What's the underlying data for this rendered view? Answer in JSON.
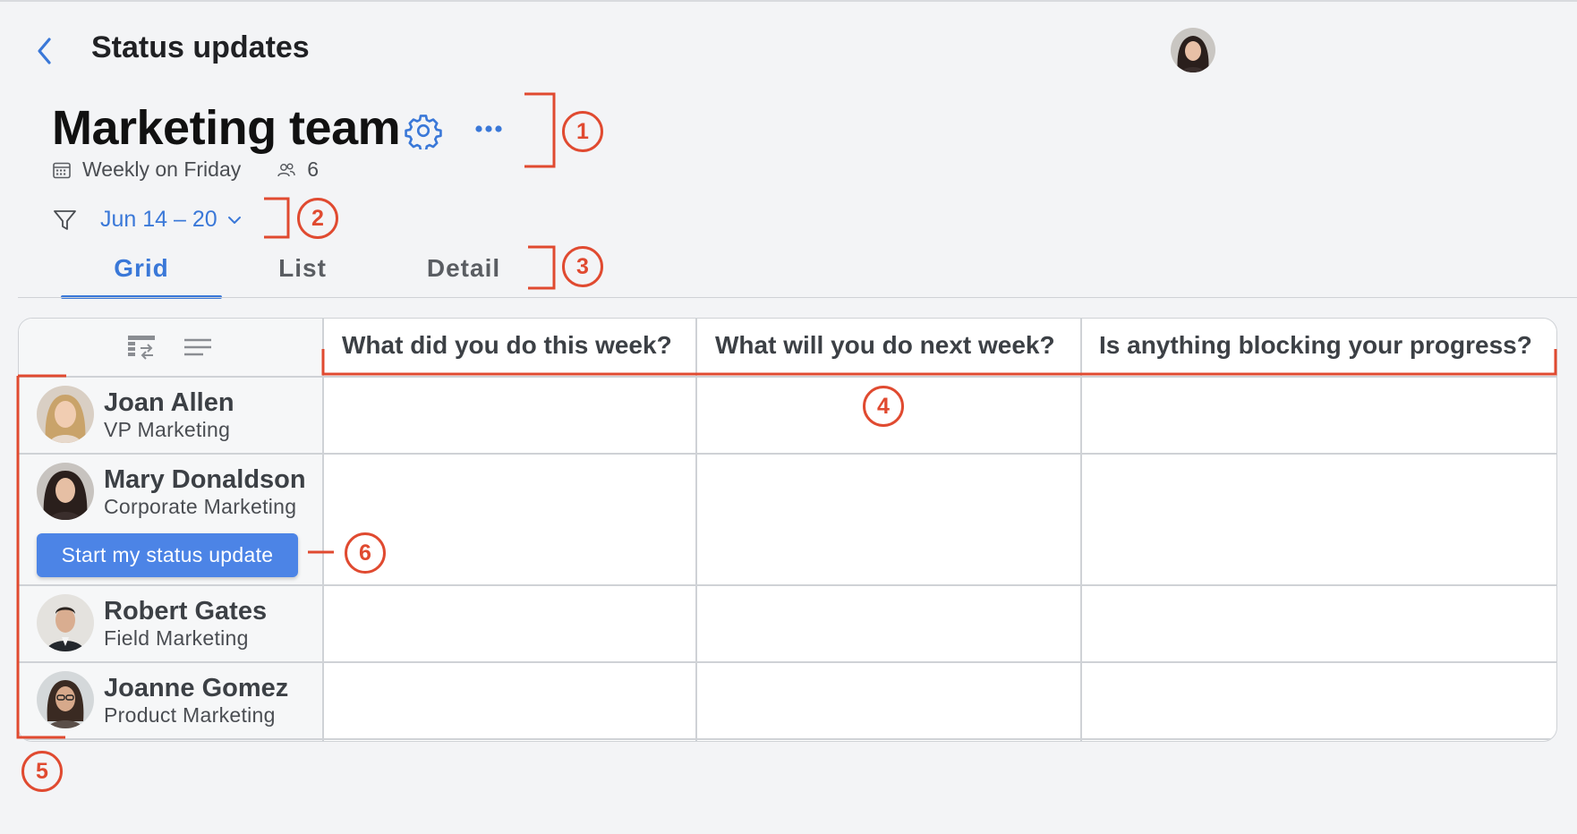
{
  "header": {
    "title": "Status updates",
    "back_icon": "chevron-left-icon",
    "current_user_avatar": "avatar-user"
  },
  "team": {
    "name": "Marketing team",
    "schedule": "Weekly on Friday",
    "member_count": "6",
    "settings_icon": "gear-icon",
    "more_icon": "more-horizontal-icon"
  },
  "filter": {
    "date_range": "Jun 14 – 20"
  },
  "tabs": [
    {
      "label": "Grid",
      "active": true
    },
    {
      "label": "List",
      "active": false
    },
    {
      "label": "Detail",
      "active": false
    }
  ],
  "grid": {
    "columns": [
      "What did you do this week?",
      "What will you do next week?",
      "Is anything blocking your progress?"
    ],
    "rows": [
      {
        "name": "Joan Allen",
        "role": "VP Marketing"
      },
      {
        "name": "Mary Donaldson",
        "role": "Corporate Marketing",
        "action": "Start my status update"
      },
      {
        "name": "Robert Gates",
        "role": "Field Marketing"
      },
      {
        "name": "Joanne Gomez",
        "role": "Product Marketing"
      }
    ]
  },
  "annotations": [
    "1",
    "2",
    "3",
    "4",
    "5",
    "6"
  ],
  "colors": {
    "accent": "#3a78d8",
    "button": "#4c84e6",
    "annotation": "#e04a30",
    "background": "#f3f4f6"
  }
}
